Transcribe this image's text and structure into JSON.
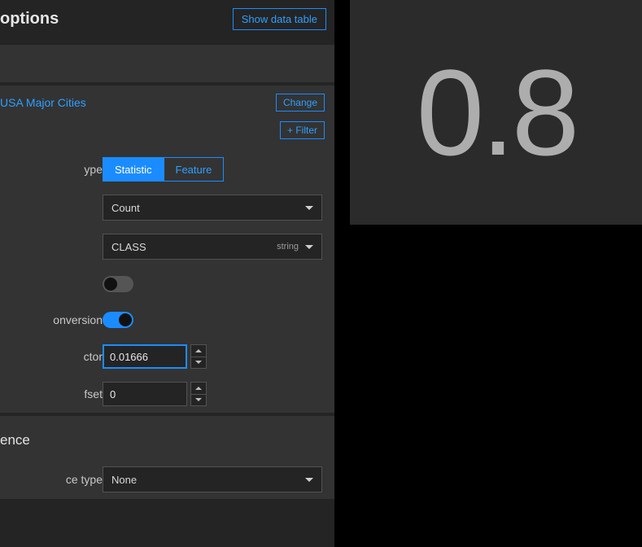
{
  "header": {
    "title": "options",
    "show_table_btn": "Show data table"
  },
  "layer": {
    "name": "USA Major Cities",
    "change_btn": "Change",
    "filter_btn": "+ Filter"
  },
  "fields": {
    "value_type_label": "ype",
    "statistic_label": "Statistic",
    "feature_label": "Feature",
    "stat_select_label": "",
    "stat_select_value": "Count",
    "field_select_value": "CLASS",
    "field_select_meta": "string",
    "split_by_label": "",
    "conversion_label": "onversion",
    "factor_label": "ctor",
    "factor_value": "0.01666",
    "offset_label": "fset",
    "offset_value": "0"
  },
  "reference": {
    "heading": "ence",
    "type_label": "ce type",
    "type_value": "None"
  },
  "preview": {
    "value": "0.8"
  }
}
